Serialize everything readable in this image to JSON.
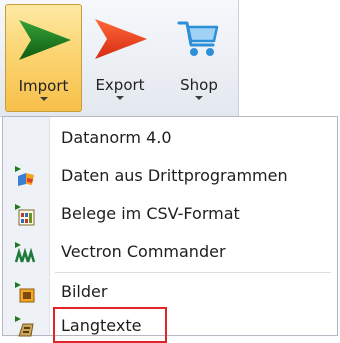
{
  "ribbon": {
    "buttons": [
      {
        "label": "Import",
        "icon": "green-arrow-icon",
        "selected": true
      },
      {
        "label": "Export",
        "icon": "red-arrow-icon"
      },
      {
        "label": "Shop",
        "icon": "shopping-cart-icon"
      }
    ]
  },
  "menu": {
    "items": [
      {
        "label": "Datanorm 4.0",
        "icon": ""
      },
      {
        "label": "Daten aus Drittprogrammen",
        "icon": "third-party-data-icon"
      },
      {
        "label": "Belege im CSV-Format",
        "icon": "csv-document-icon"
      },
      {
        "label": "Vectron Commander",
        "icon": "vectron-icon"
      },
      {
        "label": "Bilder",
        "icon": "images-icon"
      },
      {
        "label": "Langtexte",
        "icon": "long-texts-icon",
        "highlighted": true
      }
    ]
  },
  "colors": {
    "selected_button": "#f7c04b",
    "highlight_border": "#e0242a",
    "import_arrow": "#1f7a1f",
    "export_arrow": "#e8401c",
    "shop_cart": "#2d8fd8"
  }
}
